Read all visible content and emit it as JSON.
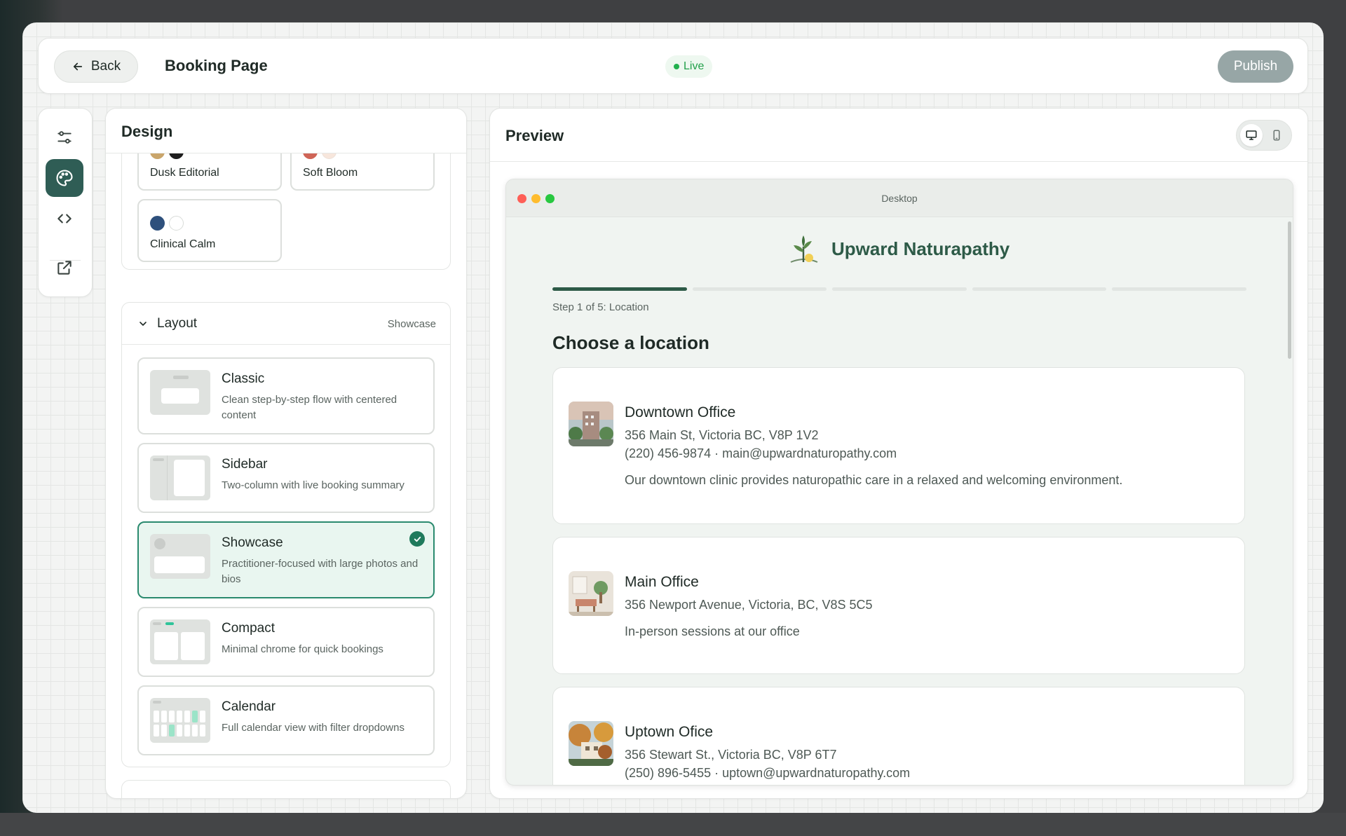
{
  "header": {
    "back_label": "Back",
    "page_title": "Booking Page",
    "status": "Live",
    "publish_label": "Publish"
  },
  "rail": {
    "items": [
      {
        "icon": "sliders-icon",
        "active": false
      },
      {
        "icon": "palette-icon",
        "active": true
      },
      {
        "icon": "code-icon",
        "active": false
      },
      {
        "icon": "external-link-icon",
        "active": false
      }
    ]
  },
  "design": {
    "title": "Design",
    "themes": [
      {
        "name": "Dusk Editorial",
        "colors": [
          "#c9a56b",
          "#1e1e1e"
        ]
      },
      {
        "name": "Soft Bloom",
        "colors": [
          "#cf6557",
          "#f7e6dc"
        ]
      },
      {
        "name": "Clinical Calm",
        "colors": [
          "#2e507c",
          "#ffffff"
        ]
      }
    ],
    "layout": {
      "title": "Layout",
      "selected": "Showcase",
      "options": [
        {
          "title": "Classic",
          "desc": "Clean step-by-step flow with centered content"
        },
        {
          "title": "Sidebar",
          "desc": "Two-column with live booking summary"
        },
        {
          "title": "Showcase",
          "desc": "Practitioner-focused with large photos and bios"
        },
        {
          "title": "Compact",
          "desc": "Minimal chrome for quick bookings"
        },
        {
          "title": "Calendar",
          "desc": "Full calendar view with filter dropdowns"
        }
      ]
    }
  },
  "preview": {
    "title": "Preview",
    "device_label": "Desktop",
    "brand_name": "Upward Naturapathy",
    "step_label": "Step 1 of 5: Location",
    "progress_current": 1,
    "progress_total": 5,
    "heading": "Choose a location",
    "locations": [
      {
        "name": "Downtown Office",
        "address": "356 Main St, Victoria BC, V8P 1V2",
        "contact": "(220) 456-9874 · main@upwardnaturopathy.com",
        "desc": "Our downtown clinic provides naturopathic care in a relaxed and welcoming environment."
      },
      {
        "name": "Main Office",
        "address": "356 Newport Avenue, Victoria, BC, V8S 5C5",
        "desc": "In-person sessions at our office"
      },
      {
        "name": "Uptown Ofice",
        "address": "356 Stewart St., Victoria BC, V8P 6T7",
        "contact": "(250) 896-5455 · uptown@upwardnaturopathy.com"
      }
    ]
  },
  "colors": {
    "accent": "#2f5d55",
    "brand": "#2d5a47",
    "selected_border": "#2a8a6e",
    "live": "#22a04a"
  }
}
